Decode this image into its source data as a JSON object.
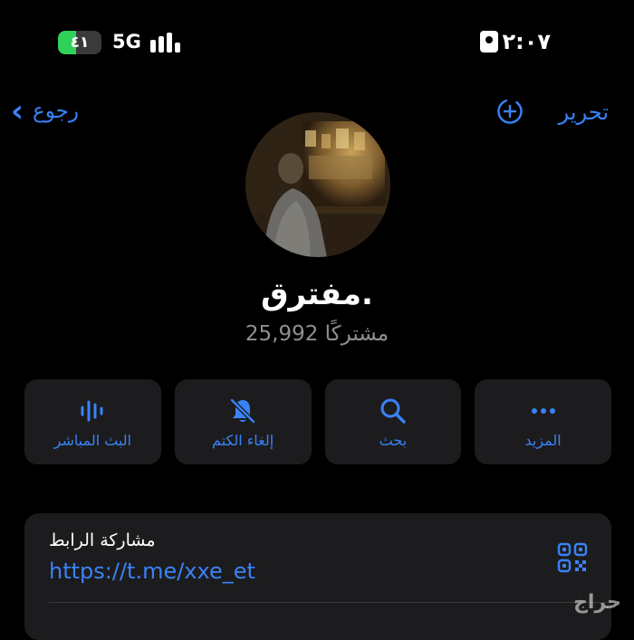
{
  "status_bar": {
    "battery": "٤١",
    "battery_level": 0.41,
    "network": "5G",
    "time": "٢:٠٧"
  },
  "nav": {
    "back_label": "رجوع",
    "edit_label": "تحرير"
  },
  "channel": {
    "title": "مفترق.",
    "subscribers": "25,992 مشتركًا"
  },
  "actions": [
    {
      "label": "البث المباشر",
      "icon": "live-stream-icon"
    },
    {
      "label": "إلغاء الكتم",
      "icon": "bell-slash-icon"
    },
    {
      "label": "بحث",
      "icon": "search-icon"
    },
    {
      "label": "المزيد",
      "icon": "more-icon"
    }
  ],
  "share": {
    "label": "مشاركة الرابط",
    "link": "https://t.me/xxe_et"
  },
  "watermark": "حراج",
  "colors": {
    "accent": "#3a82f7",
    "background": "#000000",
    "card": "#1c1c1e",
    "battery": "#30d158"
  }
}
